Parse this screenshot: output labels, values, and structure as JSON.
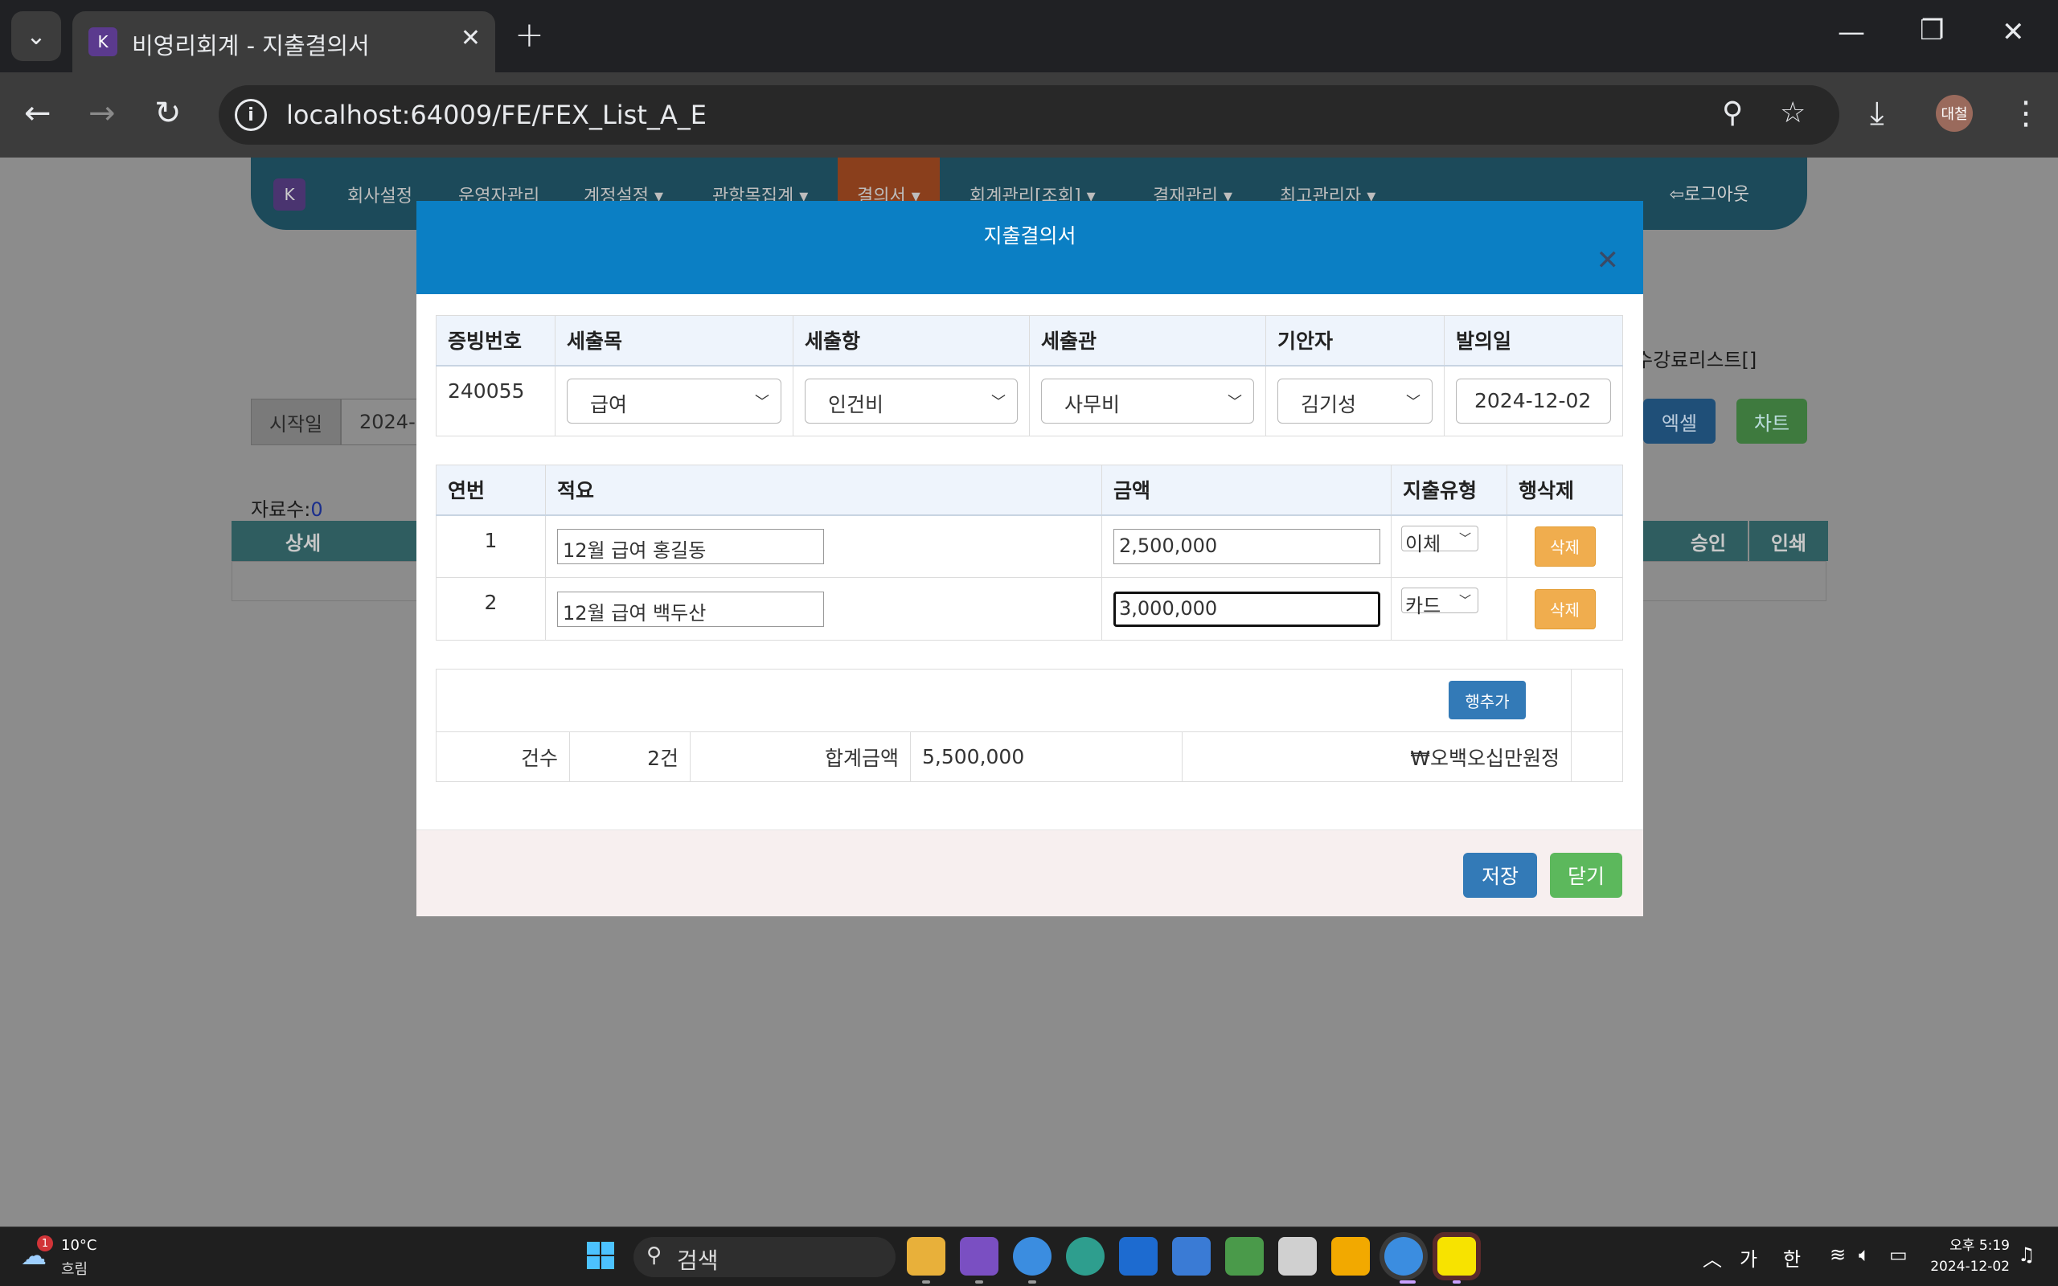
{
  "browser": {
    "tab_title": "비영리회계 - 지출결의서",
    "tab_favicon": "K",
    "url": "localhost:64009/FE/FEX_List_A_E",
    "profile": "대철"
  },
  "app_nav": {
    "logo": "K",
    "items": [
      "회사설정",
      "운영자관리",
      "계정설정 ▾",
      "관항목집계 ▾",
      "결의서 ▾",
      "회계관리[조회] ▾",
      "결재관리 ▾",
      "최고관리자 ▾"
    ],
    "logout": "로그아웃"
  },
  "page_bg": {
    "start_label": "시작일",
    "start_value": "2024-",
    "count_label": "자료수:",
    "count_value": "0",
    "link_text": "수강료리스트[]",
    "excel_label": "엑셀",
    "chart_label": "차트",
    "headers": [
      "상세",
      "승인",
      "인쇄"
    ]
  },
  "modal": {
    "title": "지출결의서",
    "header_table": {
      "columns": [
        "증빙번호",
        "세출목",
        "세출항",
        "세출관",
        "기안자",
        "발의일"
      ],
      "evidence_no": "240055",
      "se_mok": "급여",
      "se_hang": "인건비",
      "se_gwan": "사무비",
      "drafter": "김기성",
      "date": "2024-12-02"
    },
    "items_table": {
      "columns": [
        "연번",
        "적요",
        "금액",
        "지출유형",
        "행삭제"
      ],
      "rows": [
        {
          "no": "1",
          "desc": "12월 급여 홍길동",
          "amount": "2,500,000",
          "type": "이체",
          "delete": "삭제"
        },
        {
          "no": "2",
          "desc": "12월 급여 백두산",
          "amount": "3,000,000",
          "type": "카드",
          "delete": "삭제"
        }
      ]
    },
    "summary": {
      "add_row": "행추가",
      "count_label": "건수",
      "count_value": "2건",
      "total_label": "합계금액",
      "total_value": "5,500,000",
      "total_korean": "₩오백오십만원정"
    },
    "footer": {
      "save": "저장",
      "close": "닫기"
    }
  },
  "taskbar": {
    "weather_badge": "1",
    "temp": "10°C",
    "condition": "흐림",
    "search": "검색",
    "ime1": "가",
    "ime2": "한",
    "time": "오후 5:19",
    "date": "2024-12-02"
  },
  "colors": {
    "modal_header": "#0b7fc4",
    "save_button": "#337ab7",
    "close_button": "#5cb85c",
    "delete_button": "#f0ad4e"
  }
}
